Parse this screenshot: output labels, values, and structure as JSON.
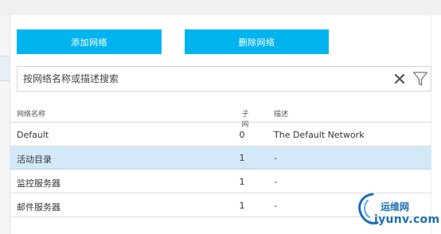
{
  "toolbar": {
    "add_label": "添加网络",
    "delete_label": "删除网络"
  },
  "search": {
    "placeholder": "按网络名称或描述搜索",
    "value": ""
  },
  "table": {
    "headers": {
      "name": "网络名称",
      "subnets": "子网",
      "description": "描述"
    },
    "rows": [
      {
        "name": "Default",
        "subnets": "0",
        "description": "The Default Network",
        "selected": false
      },
      {
        "name": "活动目录",
        "subnets": "1",
        "description": "-",
        "selected": true
      },
      {
        "name": "监控服务器",
        "subnets": "1",
        "description": "-",
        "selected": false
      },
      {
        "name": "邮件服务器",
        "subnets": "1",
        "description": "-",
        "selected": false
      }
    ]
  },
  "watermark": {
    "brand": "运维网",
    "url": "iyunv.com"
  },
  "colors": {
    "accent": "#00b4ef",
    "selected_row": "#d3e9f7",
    "watermark": "#1b6fb4"
  },
  "icons": {
    "clear": "close-icon",
    "filter": "filter-icon"
  }
}
